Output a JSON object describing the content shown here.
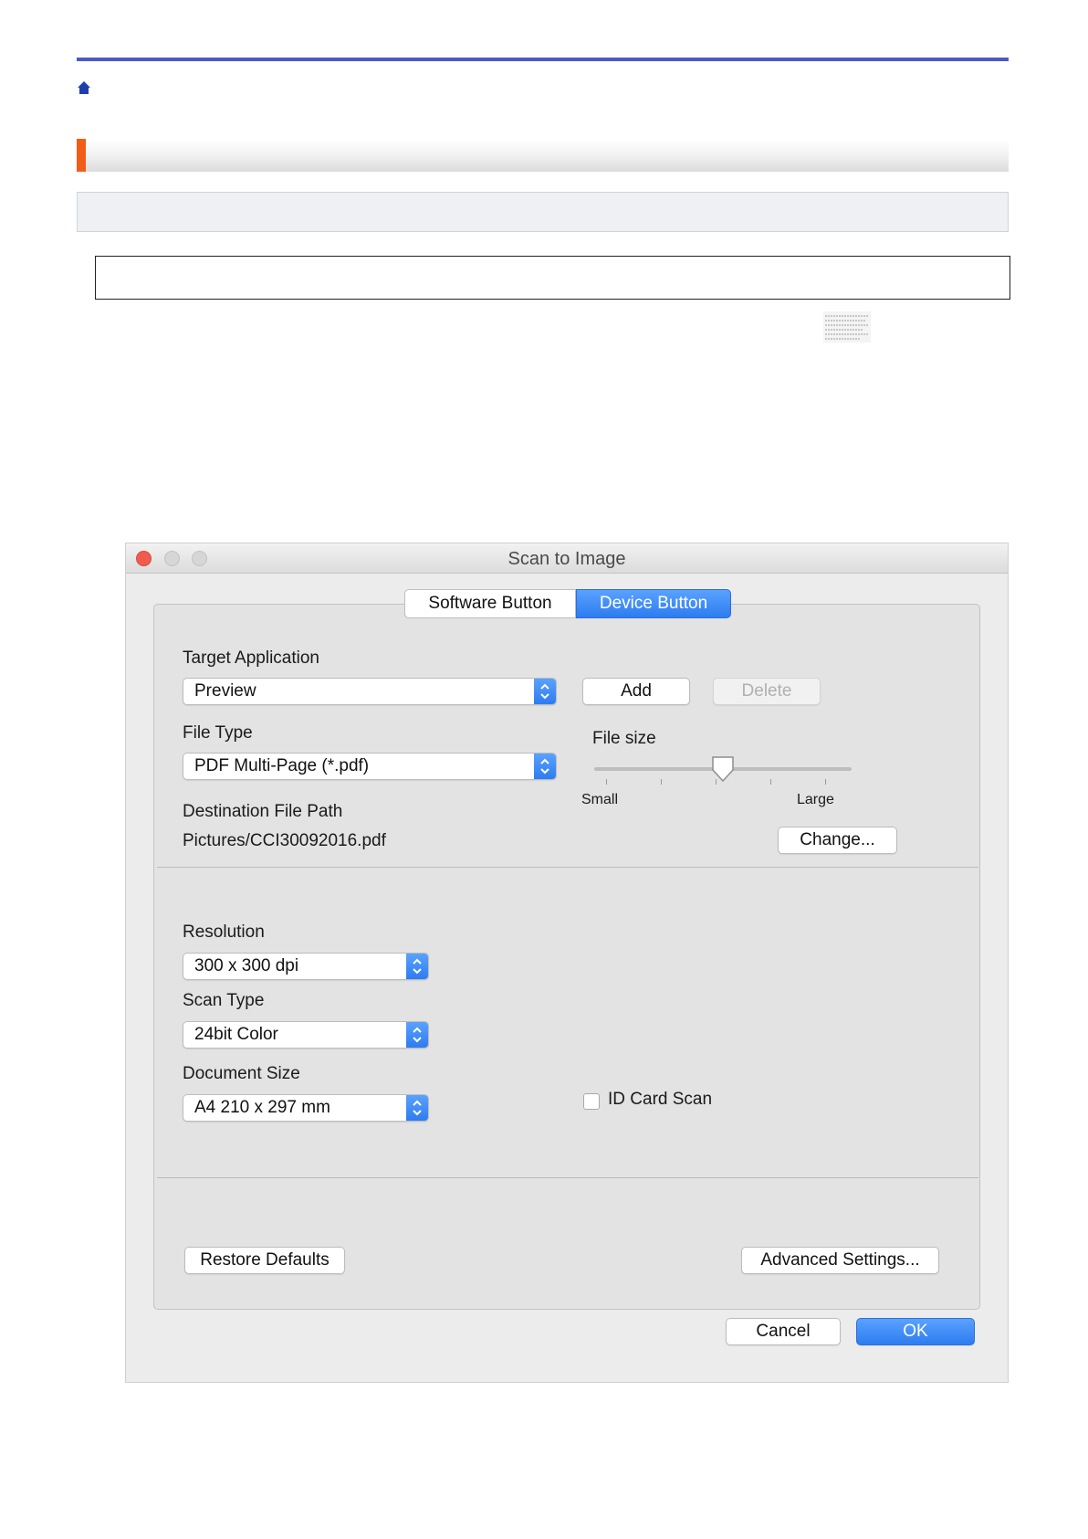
{
  "window": {
    "title": "Scan to Image"
  },
  "tabs": [
    {
      "label": "Software Button",
      "selected": false
    },
    {
      "label": "Device Button",
      "selected": true
    }
  ],
  "target_application": {
    "label": "Target Application",
    "value": "Preview",
    "add_label": "Add",
    "delete_label": "Delete"
  },
  "file_type": {
    "label": "File Type",
    "value": "PDF Multi-Page (*.pdf)"
  },
  "file_size": {
    "label": "File size",
    "small_label": "Small",
    "large_label": "Large",
    "level": 0.5
  },
  "destination": {
    "label": "Destination File Path",
    "path": "Pictures/CCI30092016.pdf",
    "change_label": "Change..."
  },
  "resolution": {
    "label": "Resolution",
    "value": "300 x 300 dpi"
  },
  "scan_type": {
    "label": "Scan Type",
    "value": "24bit Color"
  },
  "document_size": {
    "label": "Document Size",
    "value": "A4 210 x 297 mm"
  },
  "id_card_scan": {
    "label": "ID Card Scan",
    "checked": false
  },
  "footer": {
    "restore_label": "Restore Defaults",
    "advanced_label": "Advanced Settings...",
    "cancel_label": "Cancel",
    "ok_label": "OK"
  },
  "colors": {
    "accent_blue": "#2d7cf0",
    "close_red": "#f15a4e",
    "header_rule": "#4a5bc4",
    "section_accent": "#f25c19"
  }
}
